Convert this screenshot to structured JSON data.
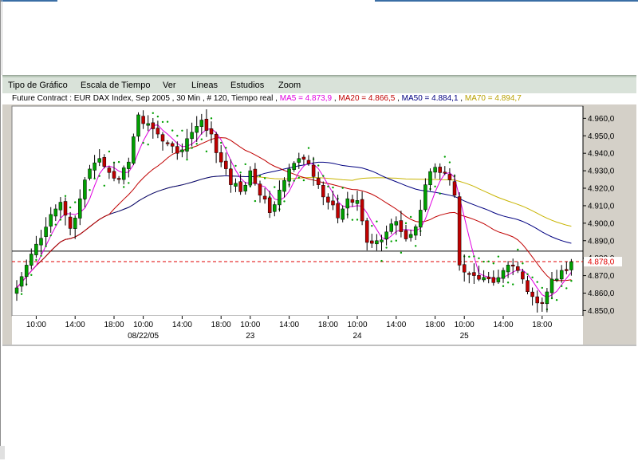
{
  "menu": {
    "items": [
      {
        "label": "Tipo de Gráfico"
      },
      {
        "label": "Escala de Tiempo"
      },
      {
        "label": "Ver"
      },
      {
        "label": "Líneas"
      },
      {
        "label": "Estudios"
      },
      {
        "label": "Zoom"
      }
    ]
  },
  "info": {
    "contract": "Future Contract : EUR DAX Index, Sep 2005 , 30 Min , # 120, Tiempo real",
    "ma5": "MA5 = 4.873,9",
    "ma20": "MA20 = 4.866,5",
    "ma50": "MA50 = 4.884,1",
    "ma70": "MA70 = 4.894,7"
  },
  "colors": {
    "up": "#00a000",
    "down": "#c00000",
    "wick": "#000000",
    "ma5": "#e000e0",
    "ma20": "#c00000",
    "ma50": "#000080",
    "ma70": "#c8b400",
    "sar": "#00a000",
    "current_line": "#e00000",
    "ref_line": "#000000"
  },
  "chart_data": {
    "type": "candlestick",
    "y_ticks": [
      "4.960,0",
      "4.950,0",
      "4.940,0",
      "4.930,0",
      "4.920,0",
      "4.910,0",
      "4.900,0",
      "4.890,0",
      "4.880,0",
      "4.870,0",
      "4.860,0",
      "4.850,0"
    ],
    "y_tick_values": [
      4960,
      4950,
      4940,
      4930,
      4920,
      4910,
      4900,
      4890,
      4880,
      4870,
      4860,
      4850
    ],
    "ylim": [
      4847,
      4967
    ],
    "current_label": "4.878,0",
    "current_value": 4878,
    "reference_value": 4884,
    "x_ticks": [
      "10:00",
      "14:00",
      "18:00",
      "10:00",
      "14:00",
      "18:00",
      "10:00",
      "14:00",
      "18:00",
      "10:00",
      "14:00",
      "18:00",
      "10:00",
      "14:00",
      "18:00"
    ],
    "x_tick_bars": [
      4,
      12,
      20,
      26,
      34,
      42,
      48,
      56,
      64,
      70,
      78,
      86,
      92,
      100,
      108
    ],
    "date_labels": [
      {
        "text": "08/22/05",
        "bar": 26
      },
      {
        "text": "23",
        "bar": 48
      },
      {
        "text": "24",
        "bar": 70
      },
      {
        "text": "25",
        "bar": 92
      }
    ],
    "close_anchors": [
      [
        0,
        4863
      ],
      [
        2,
        4876
      ],
      [
        4,
        4888
      ],
      [
        7,
        4905
      ],
      [
        9,
        4912
      ],
      [
        11,
        4897
      ],
      [
        13,
        4914
      ],
      [
        15,
        4931
      ],
      [
        17,
        4937
      ],
      [
        19,
        4929
      ],
      [
        21,
        4925
      ],
      [
        23,
        4935
      ],
      [
        25,
        4962
      ],
      [
        27,
        4957
      ],
      [
        29,
        4951
      ],
      [
        31,
        4946
      ],
      [
        33,
        4940
      ],
      [
        36,
        4952
      ],
      [
        38,
        4959
      ],
      [
        40,
        4951
      ],
      [
        42,
        4935
      ],
      [
        44,
        4922
      ],
      [
        46,
        4918
      ],
      [
        48,
        4930
      ],
      [
        50,
        4916
      ],
      [
        52,
        4906
      ],
      [
        54,
        4919
      ],
      [
        56,
        4931
      ],
      [
        58,
        4937
      ],
      [
        60,
        4934
      ],
      [
        62,
        4922
      ],
      [
        64,
        4912
      ],
      [
        66,
        4903
      ],
      [
        68,
        4914
      ],
      [
        70,
        4913
      ],
      [
        72,
        4889
      ],
      [
        74,
        4890
      ],
      [
        76,
        4895
      ],
      [
        78,
        4901
      ],
      [
        80,
        4891
      ],
      [
        82,
        4898
      ],
      [
        84,
        4922
      ],
      [
        86,
        4932
      ],
      [
        88,
        4929
      ],
      [
        90,
        4916
      ],
      [
        91,
        4876
      ],
      [
        92,
        4872
      ],
      [
        94,
        4870
      ],
      [
        96,
        4869
      ],
      [
        98,
        4866
      ],
      [
        100,
        4873
      ],
      [
        102,
        4876
      ],
      [
        104,
        4868
      ],
      [
        106,
        4858
      ],
      [
        108,
        4854
      ],
      [
        110,
        4868
      ],
      [
        112,
        4873
      ],
      [
        114,
        4878
      ]
    ]
  }
}
